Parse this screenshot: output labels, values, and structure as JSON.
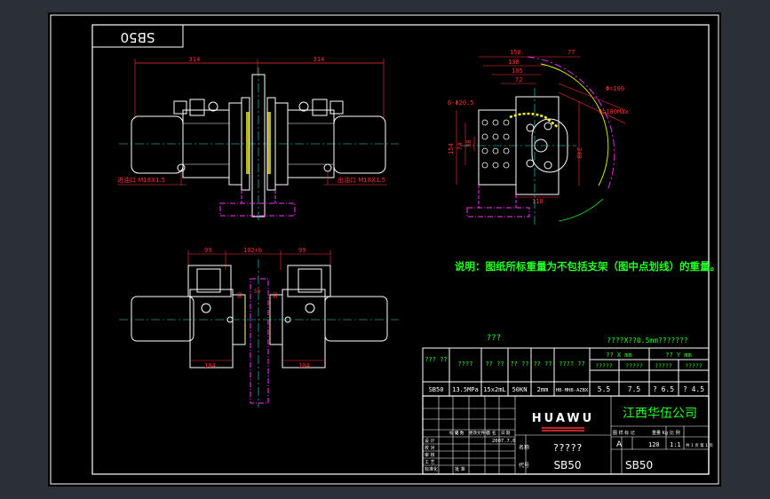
{
  "colors": {
    "background": "#2b2f36",
    "paper": "#000000",
    "outline": "#ffffff",
    "dimension": "#ff3030",
    "hidden": "#ff2bff",
    "center": "#33e0e0",
    "note": "#22ff22",
    "arc": "#e0ff00",
    "yellow_detail": "#ffff33"
  },
  "title_tag": "SB50",
  "front_view": {
    "dim_left": "314",
    "dim_right": "314",
    "port_left": "进油口 M18X1.5",
    "port_right": "出油口 M18X1.5"
  },
  "side_view": {
    "dims": [
      "150",
      "77",
      "138",
      "105",
      "72",
      "6-Φ20.5",
      "Φ=100",
      "Φ=180Max",
      "154",
      "74",
      "38",
      "110",
      "240"
    ]
  },
  "top_view": {
    "dims": [
      "99",
      "102+b",
      "99",
      "104",
      "104",
      "82",
      "82",
      "50"
    ]
  },
  "note": "说明：图纸所标重量为不包括支架（图中点划线）的重量。",
  "spec_table": {
    "caption": "???",
    "right_caption": "????X??0.5mm???????",
    "headers": [
      "???\n??",
      "????",
      "??\n??",
      "??\n??",
      "??\n??",
      "????\n??"
    ],
    "values": [
      "SB50",
      "13.5MPa",
      "15x2mL",
      "50KN",
      "2mm",
      "HB-MHB-AZBX"
    ],
    "x_head": "?? X  mm",
    "y_head": "?? Y  mm",
    "sub_heads": [
      "?????",
      "?????",
      "?????",
      "?????"
    ],
    "xy_values": [
      "5.5",
      "7.5",
      "? 6.5",
      "? 4.5"
    ]
  },
  "title_block": {
    "brand": "HUAWU",
    "company": "江西华伍公司",
    "drawing_name": "?????",
    "drawing_number": "SB50",
    "model": "SB50",
    "date": "2007.7.6",
    "stage_label": "图 样 标 记",
    "weight_label": "重量 Kg",
    "scale_label": "比 例",
    "stage": "A",
    "weight": "120",
    "scale": "1:1",
    "sheet": "共 1 页  第 1 页",
    "label_name": "名称",
    "label_code": "代号",
    "row_labels": [
      "标 记",
      "处 数",
      "更改文件号",
      "签 名",
      "日 期"
    ],
    "sign_rows": [
      "设 计",
      "校 对",
      "审 核",
      "工 艺",
      "标准化",
      "批 准"
    ]
  }
}
